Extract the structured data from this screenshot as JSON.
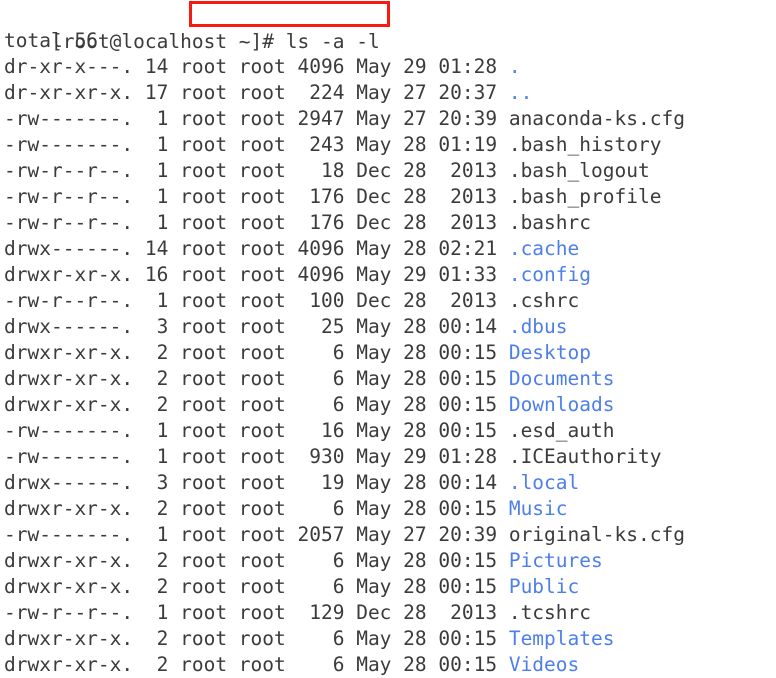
{
  "terminal": {
    "colors": {
      "background": "#ffffff",
      "text": "#3b3b3b",
      "directory": "#4d7fea",
      "highlight_box": "#f61b10"
    },
    "prompt": {
      "text": "[root@localhost ~]# ",
      "command": "ls -a -l",
      "full_line": "[root@localhost ~]# ls -a -l"
    },
    "total_line": "total 56",
    "columns": [
      "permissions",
      "links",
      "owner",
      "group",
      "size",
      "month",
      "day",
      "time",
      "name"
    ],
    "entries": [
      {
        "permissions": "dr-xr-x---.",
        "links": "14",
        "owner": "root",
        "group": "root",
        "size": "4096",
        "month": "May",
        "day": "29",
        "time": "01:28",
        "name": ".",
        "type": "dir"
      },
      {
        "permissions": "dr-xr-xr-x.",
        "links": "17",
        "owner": "root",
        "group": "root",
        "size": "224",
        "month": "May",
        "day": "27",
        "time": "20:37",
        "name": "..",
        "type": "dir"
      },
      {
        "permissions": "-rw-------.",
        "links": "1",
        "owner": "root",
        "group": "root",
        "size": "2947",
        "month": "May",
        "day": "27",
        "time": "20:39",
        "name": "anaconda-ks.cfg",
        "type": "file"
      },
      {
        "permissions": "-rw-------.",
        "links": "1",
        "owner": "root",
        "group": "root",
        "size": "243",
        "month": "May",
        "day": "28",
        "time": "01:19",
        "name": ".bash_history",
        "type": "file"
      },
      {
        "permissions": "-rw-r--r--.",
        "links": "1",
        "owner": "root",
        "group": "root",
        "size": "18",
        "month": "Dec",
        "day": "28",
        "time": "2013",
        "name": ".bash_logout",
        "type": "file"
      },
      {
        "permissions": "-rw-r--r--.",
        "links": "1",
        "owner": "root",
        "group": "root",
        "size": "176",
        "month": "Dec",
        "day": "28",
        "time": "2013",
        "name": ".bash_profile",
        "type": "file"
      },
      {
        "permissions": "-rw-r--r--.",
        "links": "1",
        "owner": "root",
        "group": "root",
        "size": "176",
        "month": "Dec",
        "day": "28",
        "time": "2013",
        "name": ".bashrc",
        "type": "file"
      },
      {
        "permissions": "drwx------.",
        "links": "14",
        "owner": "root",
        "group": "root",
        "size": "4096",
        "month": "May",
        "day": "28",
        "time": "02:21",
        "name": ".cache",
        "type": "dir"
      },
      {
        "permissions": "drwxr-xr-x.",
        "links": "16",
        "owner": "root",
        "group": "root",
        "size": "4096",
        "month": "May",
        "day": "29",
        "time": "01:33",
        "name": ".config",
        "type": "dir"
      },
      {
        "permissions": "-rw-r--r--.",
        "links": "1",
        "owner": "root",
        "group": "root",
        "size": "100",
        "month": "Dec",
        "day": "28",
        "time": "2013",
        "name": ".cshrc",
        "type": "file"
      },
      {
        "permissions": "drwx------.",
        "links": "3",
        "owner": "root",
        "group": "root",
        "size": "25",
        "month": "May",
        "day": "28",
        "time": "00:14",
        "name": ".dbus",
        "type": "dir"
      },
      {
        "permissions": "drwxr-xr-x.",
        "links": "2",
        "owner": "root",
        "group": "root",
        "size": "6",
        "month": "May",
        "day": "28",
        "time": "00:15",
        "name": "Desktop",
        "type": "dir"
      },
      {
        "permissions": "drwxr-xr-x.",
        "links": "2",
        "owner": "root",
        "group": "root",
        "size": "6",
        "month": "May",
        "day": "28",
        "time": "00:15",
        "name": "Documents",
        "type": "dir"
      },
      {
        "permissions": "drwxr-xr-x.",
        "links": "2",
        "owner": "root",
        "group": "root",
        "size": "6",
        "month": "May",
        "day": "28",
        "time": "00:15",
        "name": "Downloads",
        "type": "dir"
      },
      {
        "permissions": "-rw-------.",
        "links": "1",
        "owner": "root",
        "group": "root",
        "size": "16",
        "month": "May",
        "day": "28",
        "time": "00:15",
        "name": ".esd_auth",
        "type": "file"
      },
      {
        "permissions": "-rw-------.",
        "links": "1",
        "owner": "root",
        "group": "root",
        "size": "930",
        "month": "May",
        "day": "29",
        "time": "01:28",
        "name": ".ICEauthority",
        "type": "file"
      },
      {
        "permissions": "drwx------.",
        "links": "3",
        "owner": "root",
        "group": "root",
        "size": "19",
        "month": "May",
        "day": "28",
        "time": "00:14",
        "name": ".local",
        "type": "dir"
      },
      {
        "permissions": "drwxr-xr-x.",
        "links": "2",
        "owner": "root",
        "group": "root",
        "size": "6",
        "month": "May",
        "day": "28",
        "time": "00:15",
        "name": "Music",
        "type": "dir"
      },
      {
        "permissions": "-rw-------.",
        "links": "1",
        "owner": "root",
        "group": "root",
        "size": "2057",
        "month": "May",
        "day": "27",
        "time": "20:39",
        "name": "original-ks.cfg",
        "type": "file"
      },
      {
        "permissions": "drwxr-xr-x.",
        "links": "2",
        "owner": "root",
        "group": "root",
        "size": "6",
        "month": "May",
        "day": "28",
        "time": "00:15",
        "name": "Pictures",
        "type": "dir"
      },
      {
        "permissions": "drwxr-xr-x.",
        "links": "2",
        "owner": "root",
        "group": "root",
        "size": "6",
        "month": "May",
        "day": "28",
        "time": "00:15",
        "name": "Public",
        "type": "dir"
      },
      {
        "permissions": "-rw-r--r--.",
        "links": "1",
        "owner": "root",
        "group": "root",
        "size": "129",
        "month": "Dec",
        "day": "28",
        "time": "2013",
        "name": ".tcshrc",
        "type": "file"
      },
      {
        "permissions": "drwxr-xr-x.",
        "links": "2",
        "owner": "root",
        "group": "root",
        "size": "6",
        "month": "May",
        "day": "28",
        "time": "00:15",
        "name": "Templates",
        "type": "dir"
      },
      {
        "permissions": "drwxr-xr-x.",
        "links": "2",
        "owner": "root",
        "group": "root",
        "size": "6",
        "month": "May",
        "day": "28",
        "time": "00:15",
        "name": "Videos",
        "type": "dir"
      }
    ]
  }
}
